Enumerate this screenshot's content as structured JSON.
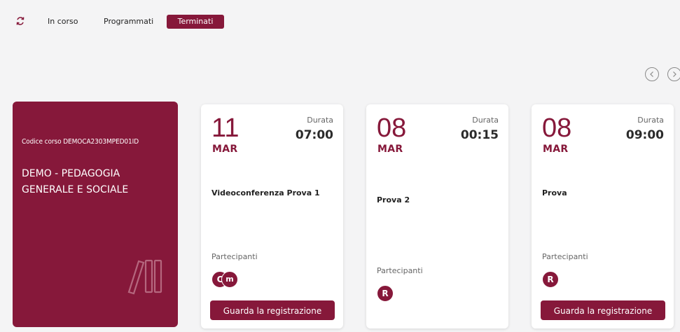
{
  "tabs": [
    {
      "label": "In corso"
    },
    {
      "label": "Programmati"
    },
    {
      "label": "Terminati",
      "active": true
    }
  ],
  "course": {
    "code": "Codice corso DEMOCA2303MPED01ID",
    "title": "DEMO - PEDAGOGIA GENERALE E SOCIALE"
  },
  "events": [
    {
      "day": "11",
      "month": "MAR",
      "duration_label": "Durata",
      "duration": "07:00",
      "title": "Videoconferenza Prova 1",
      "participants_label": "Partecipanti",
      "participants": [
        "C",
        "m"
      ],
      "action_label": "Guarda la registrazione"
    },
    {
      "day": "08",
      "month": "MAR",
      "duration_label": "Durata",
      "duration": "00:15",
      "title": "Prova 2",
      "participants_label": "Partecipanti",
      "participants": [
        "R"
      ]
    },
    {
      "day": "08",
      "month": "MAR",
      "duration_label": "Durata",
      "duration": "09:00",
      "title": "Prova",
      "participants_label": "Partecipanti",
      "participants": [
        "R"
      ],
      "action_label": "Guarda la registrazione"
    }
  ],
  "colors": {
    "brand": "#86183a",
    "background": "#f4f4f5",
    "card": "#ffffff"
  },
  "icons": {
    "refresh": "refresh-icon",
    "prev": "chevron-left-icon",
    "next": "chevron-right-icon",
    "course": "books-icon"
  }
}
